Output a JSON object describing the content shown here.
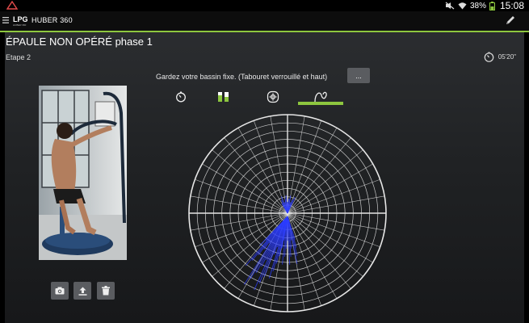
{
  "status_bar": {
    "battery": "38%",
    "time": "15:08"
  },
  "app": {
    "title": "HUBER 360",
    "logo_text": "LPG",
    "logo_subtext": "HUBER 360"
  },
  "exercise": {
    "title": "ÉPAULE NON OPÉRÉ phase 1",
    "step": "Etape 2",
    "timer": "05'20\""
  },
  "instruction": "Gardez votre bassin fixe. (Tabouret verrouillé et haut)",
  "more_button": "...",
  "tabs": [
    {
      "icon": "timer-icon",
      "active": false
    },
    {
      "icon": "bars-icon",
      "active": false
    },
    {
      "icon": "target-icon",
      "active": false
    },
    {
      "icon": "trajectory-icon",
      "active": true
    }
  ],
  "toolbar": {
    "icons": [
      "camera-icon",
      "upload-icon",
      "trash-icon"
    ]
  },
  "colors": {
    "accent": "#8dc63f",
    "grid": "#e6e6e6",
    "trace": "#2b3cff"
  }
}
